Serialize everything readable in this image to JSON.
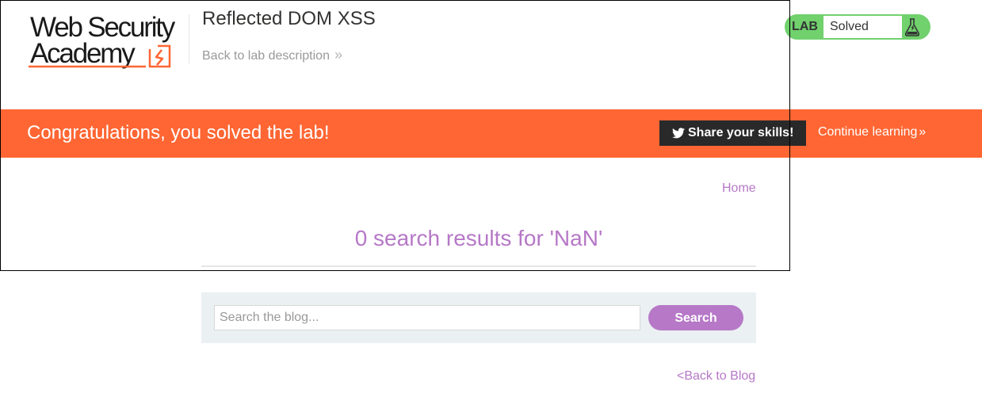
{
  "header": {
    "logo_line1": "Web Security",
    "logo_line2": "Academy",
    "lab_title": "Reflected DOM XSS",
    "back_to_description": "Back to lab description",
    "chevron": "»"
  },
  "status": {
    "lab_label": "LAB",
    "state": "Solved",
    "icon": "flask-icon",
    "accent": "#70d16d"
  },
  "banner": {
    "message": "Congratulations, you solved the lab!",
    "share_label": "Share your skills!",
    "continue_label": "Continue learning",
    "continue_chevron": "»",
    "background": "#ff6633"
  },
  "nav": {
    "home": "Home"
  },
  "results": {
    "heading": "0 search results for 'NaN'"
  },
  "search": {
    "placeholder": "Search the blog...",
    "value": "",
    "button_label": "Search"
  },
  "footer": {
    "back_to_blog": "<Back to Blog"
  },
  "colors": {
    "link_purple": "#b678c7",
    "search_bg": "#ebf0f2"
  }
}
